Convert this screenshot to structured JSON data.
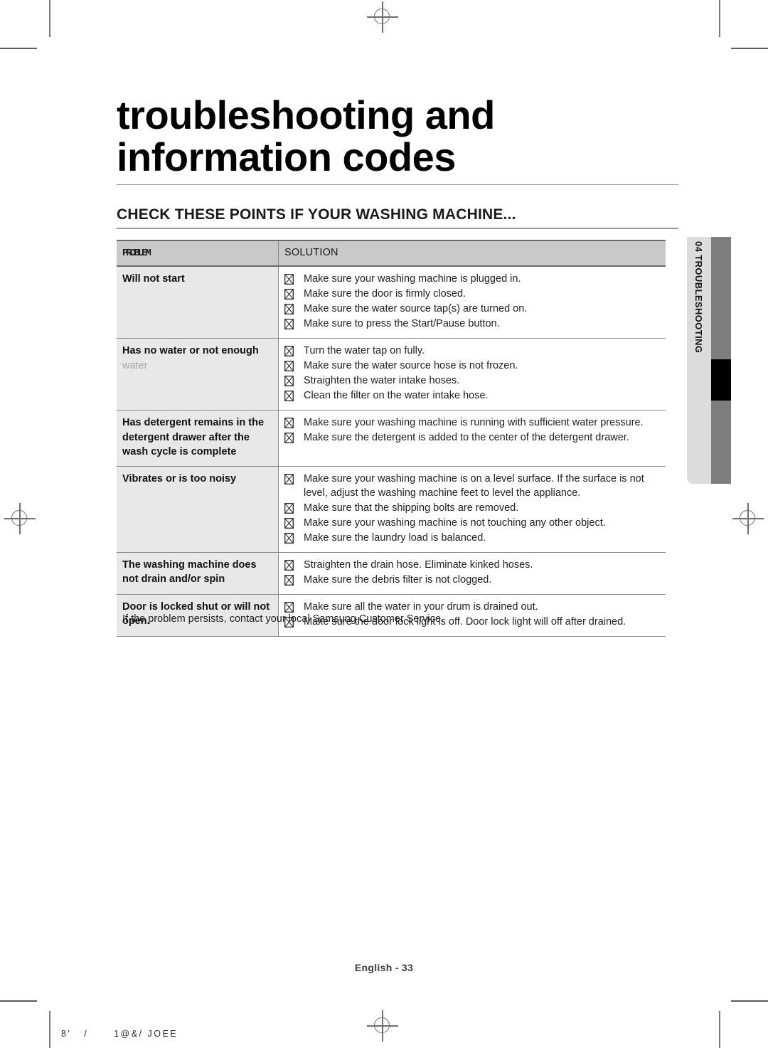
{
  "document": {
    "title_line1": "troubleshooting and",
    "title_line2": "information codes",
    "section_title": "CHECK THESE POINTS IF YOUR WASHING MACHINE...",
    "page_number": "English - 33",
    "print_code": "8'   /      1@&/ JOEE"
  },
  "side_tab": {
    "label": "04 TROUBLESHOOTING"
  },
  "table": {
    "headers": {
      "problem": "PROBLEM",
      "solution": "SOLUTION"
    },
    "bullet_glyph": "crossed-box",
    "rows": [
      {
        "problem": "Will not start",
        "problem_sub": "",
        "solutions": [
          "Make sure your washing machine is plugged in.",
          "Make sure the door is firmly closed.",
          "Make sure the water source tap(s) are turned on.",
          "Make sure to press the Start/Pause button."
        ]
      },
      {
        "problem": "Has no water or not enough",
        "problem_sub": "water",
        "solutions": [
          "Turn the water tap on fully.",
          "Make sure the water source hose is not frozen.",
          "Straighten the water intake hoses.",
          "Clean the filter on the water intake hose."
        ]
      },
      {
        "problem": "Has detergent remains in the detergent drawer after the wash cycle is complete",
        "problem_sub": "",
        "solutions": [
          "Make sure your washing machine is running with sufficient water pressure.",
          "Make sure the detergent is added to the center of the detergent drawer."
        ]
      },
      {
        "problem": "Vibrates or is too noisy",
        "problem_sub": "",
        "solutions": [
          "Make sure your washing machine is on a level surface. If the surface is not level, adjust the washing machine feet to level the appliance.",
          "Make sure that the shipping bolts are removed.",
          "Make sure your washing machine is not touching any other object.",
          "Make sure the laundry load is balanced."
        ]
      },
      {
        "problem": "The washing machine does not drain and/or spin",
        "problem_sub": "",
        "solutions": [
          "Straighten the drain hose. Eliminate kinked hoses.",
          "Make sure the debris filter is not clogged."
        ]
      },
      {
        "problem": "Door is locked shut or will not open.",
        "problem_sub": "",
        "solutions": [
          "Make sure all the water in your drum is drained out.",
          "Make sure the door lock light is off. Door lock light will off after drained."
        ]
      }
    ],
    "note": "If the problem persists, contact your local Samsung Customer Service."
  },
  "colors": {
    "header_row_bg": "#c9c9c9",
    "problem_col_bg": "#e8e8e8",
    "rule": "#9a9a9a",
    "tab_panel": "#dcdcdc",
    "tab_bar": "#7e7e7e",
    "tab_marker": "#000000"
  }
}
